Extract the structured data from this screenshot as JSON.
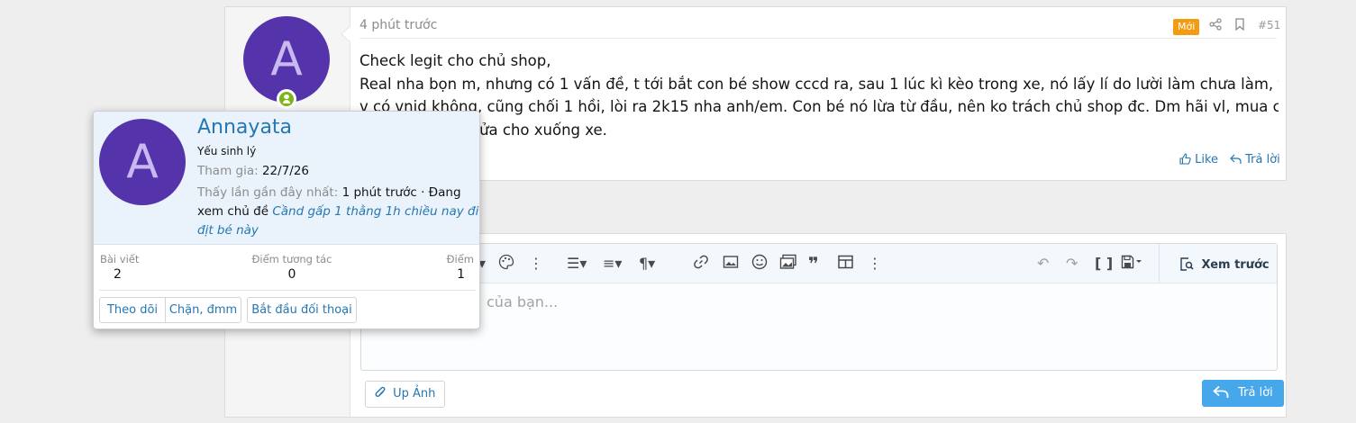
{
  "post": {
    "time": "4 phút trước",
    "badge_new": "Mới",
    "post_number": "#51",
    "avatar_letter": "A",
    "body_lines": [
      "Check legit cho chủ shop,",
      "Real nha bọn m, nhưng có 1 vấn đề, t tới bắt con bé show cccd ra, sau 1 lúc kì kèo trong xe, nó lấy lí do lười làm chưa làm, t hỏi",
      "v có vnid không, cũng chối 1 hồi, lòi ra 2k15 nha anh/em. Con bé nó lừa từ đầu, nên ko trách chủ shop đc. Dm hãi vl, mua cho lì",
      "xì 500k rồi mở cửa cho xuống xe."
    ],
    "like_label": "Like",
    "reply_label": "Trả lời"
  },
  "editor": {
    "placeholder_visible": "của bạn...",
    "preview_label": "Xem trước",
    "upload_label": "Up Ảnh",
    "reply_button": "Trả lời"
  },
  "popup": {
    "avatar_letter": "A",
    "username": "Annayata",
    "user_title": "Yếu sinh lý",
    "joined_label": "Tham gia:",
    "joined_value": "22/7/26",
    "last_seen_label": "Thấy lần gần đây nhất:",
    "last_seen_value": "1 phút trước · Đang",
    "last_seen_value_2": "xem chủ đề",
    "thread_link_1": "Cầnd gấp 1 thằng 1h chiều nay đi",
    "thread_link_2": "địt bé này",
    "stats": [
      {
        "label": "Bài viết",
        "value": "2"
      },
      {
        "label": "Điểm tương tác",
        "value": "0"
      },
      {
        "label": "Điểm",
        "value": "1"
      }
    ],
    "buttons": {
      "follow": "Theo dõi",
      "block": "Chặn, đmm",
      "start_conversation": "Bắt đầu đối thoại"
    }
  },
  "colors": {
    "avatar": "#5533aa",
    "link": "#2577b1",
    "badge_new": "#f39c12",
    "online": "#7cb518",
    "reply_button": "#47a7eb"
  }
}
